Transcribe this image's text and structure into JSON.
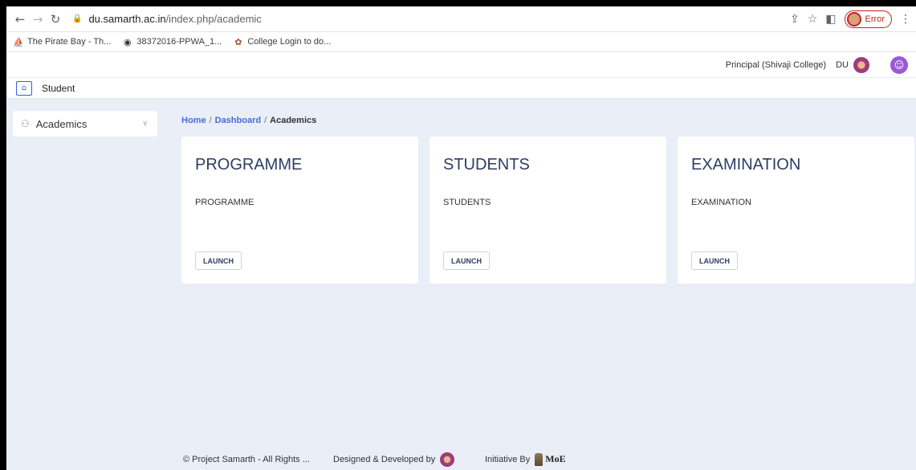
{
  "browser": {
    "url_host": "du.samarth.ac.in",
    "url_path": "/index.php/academic",
    "error_label": "Error",
    "bookmarks": [
      {
        "label": "The Pirate Bay - Th...",
        "icon": "ship-icon"
      },
      {
        "label": "38372016-PPWA_1...",
        "icon": "globe-icon"
      },
      {
        "label": "College Login to do...",
        "icon": "college-icon"
      }
    ]
  },
  "header": {
    "role": "Principal (Shivaji College)",
    "org": "DU"
  },
  "subheader": {
    "label": "Student"
  },
  "sidebar": {
    "items": [
      {
        "label": "Academics"
      }
    ]
  },
  "breadcrumb": {
    "home": "Home",
    "sep": "/",
    "dashboard": "Dashboard",
    "current": "Academics"
  },
  "cards": [
    {
      "title": "PROGRAMME",
      "desc": "PROGRAMME",
      "button": "LAUNCH"
    },
    {
      "title": "STUDENTS",
      "desc": "STUDENTS",
      "button": "LAUNCH"
    },
    {
      "title": "EXAMINATION",
      "desc": "EXAMINATION",
      "button": "LAUNCH"
    }
  ],
  "footer": {
    "copyright": "© Project Samarth - All Rights ...",
    "designed": "Designed & Developed by",
    "initiative": "Initiative By",
    "moe": "MoE"
  },
  "colors": {
    "accent": "#4a6ad9",
    "page_bg": "#e9eef7",
    "card_title": "#2c3e63"
  }
}
